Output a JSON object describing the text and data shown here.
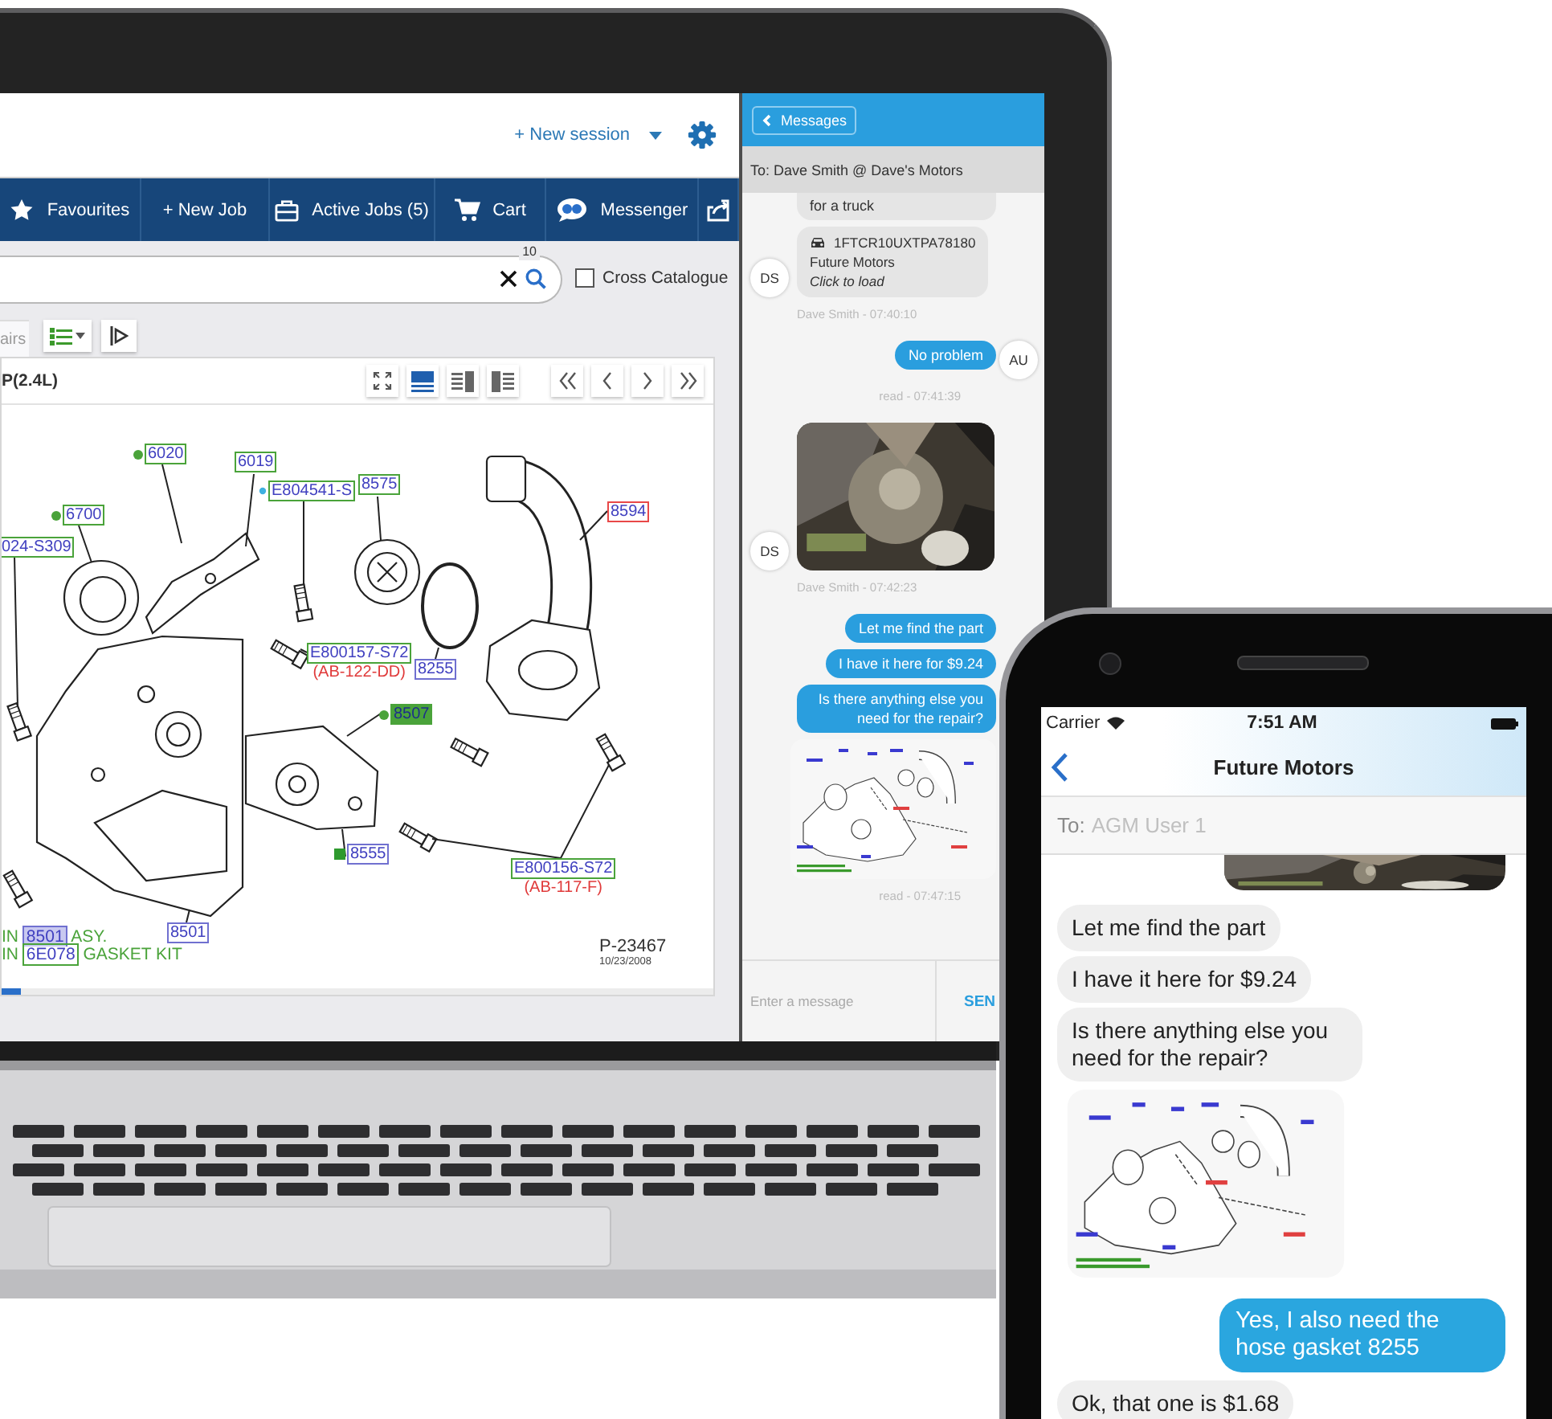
{
  "app": {
    "new_session": "+ New session",
    "nav": [
      {
        "kind": "favourites",
        "label": "Favourites"
      },
      {
        "kind": "new_job",
        "label": "+ New Job"
      },
      {
        "kind": "active_jobs",
        "label": "Active Jobs (5)"
      },
      {
        "kind": "cart",
        "label": "Cart"
      },
      {
        "kind": "messenger",
        "label": "Messenger"
      },
      {
        "kind": "share"
      }
    ],
    "search": {
      "count": "10"
    },
    "cross_catalogue": {
      "label": "Cross Catalogue",
      "checked": false
    },
    "tabs": [
      {
        "label": "airs",
        "selected": true
      }
    ],
    "diagram": {
      "title": "P(2.4L)",
      "view_modes": [
        {
          "selected": true
        },
        {
          "selected": false
        },
        {
          "selected": false
        }
      ],
      "labels": [
        {
          "text": "6020"
        },
        {
          "text": "6019"
        },
        {
          "text": "E804541-S"
        },
        {
          "text": "8575"
        },
        {
          "text": "8594"
        },
        {
          "text": "6700"
        },
        {
          "text": "024-S309"
        },
        {
          "text": "E800157-S72",
          "note": "(AB-122-DD)"
        },
        {
          "text": "8255"
        },
        {
          "text": "8507"
        },
        {
          "text": "8555"
        },
        {
          "text": "E800156-S72",
          "note": "(AB-117-F)"
        },
        {
          "text": "8501"
        }
      ],
      "footnotes": [
        {
          "prefix": "IN",
          "part": "8501",
          "suffix": "ASY."
        },
        {
          "prefix": "IN",
          "part": "6E078",
          "suffix": "GASKET  KIT"
        }
      ],
      "drawing_number": "P-23467",
      "date": "10/23/2008"
    }
  },
  "messenger": {
    "back": "Messages",
    "to": "To: Dave Smith @ Dave's Motors",
    "messages": [
      {
        "kind": "in_text",
        "text": "for a truck"
      },
      {
        "kind": "vehicle",
        "vin": "1FTCR10UXTPA78180",
        "name": "Future Motors",
        "action": "Click to load",
        "avatar": "DS",
        "meta": "Dave Smith - 07:40:10"
      },
      {
        "kind": "out_text",
        "text": "No problem",
        "avatar": "AU",
        "meta": "read - 07:41:39"
      },
      {
        "kind": "in_photo",
        "avatar": "DS",
        "meta": "Dave Smith - 07:42:23"
      },
      {
        "kind": "out_text",
        "text": "Let me find the part"
      },
      {
        "kind": "out_text",
        "text": "I have it here for $9.24"
      },
      {
        "kind": "out_text",
        "text": "Is there anything else you need for the repair?"
      },
      {
        "kind": "out_diagram",
        "meta": "read - 07:47:15"
      }
    ],
    "placeholder": "Enter a message",
    "send": "SEN"
  },
  "phone": {
    "carrier": "Carrier",
    "time": "7:51 AM",
    "title": "Future Motors",
    "to_label": "To:",
    "to": "AGM User 1",
    "messages": [
      {
        "kind": "out_photo"
      },
      {
        "kind": "in_text",
        "text": "Let me find the part"
      },
      {
        "kind": "in_text",
        "text": "I have it here for $9.24"
      },
      {
        "kind": "in_text",
        "text": "Is there anything else you need for the repair?"
      },
      {
        "kind": "in_diagram"
      },
      {
        "kind": "out_text",
        "text": "Yes, I also need the hose gasket 8255"
      },
      {
        "kind": "in_text",
        "text": "Ok, that one is $1.68"
      }
    ]
  }
}
